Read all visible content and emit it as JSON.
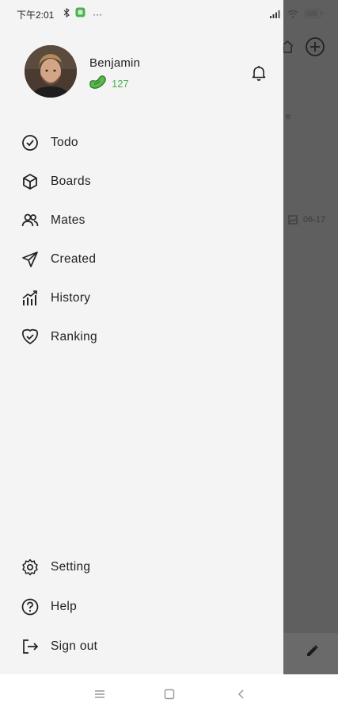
{
  "status_bar": {
    "time": "下午2:01",
    "more": "···"
  },
  "profile": {
    "name": "Benjamin",
    "points": "127"
  },
  "menu": {
    "items": [
      {
        "label": "Todo",
        "icon": "check-circle-icon"
      },
      {
        "label": "Boards",
        "icon": "cube-icon"
      },
      {
        "label": "Mates",
        "icon": "users-icon"
      },
      {
        "label": "Created",
        "icon": "send-icon"
      },
      {
        "label": "History",
        "icon": "bar-chart-icon"
      },
      {
        "label": "Ranking",
        "icon": "heart-check-icon"
      }
    ]
  },
  "footer_menu": {
    "items": [
      {
        "label": "Setting",
        "icon": "gear-icon"
      },
      {
        "label": "Help",
        "icon": "help-circle-icon"
      },
      {
        "label": "Sign out",
        "icon": "sign-out-icon"
      }
    ]
  },
  "background": {
    "partial_text_1": "e",
    "date": "06-17"
  },
  "colors": {
    "drawer_bg": "#f4f4f4",
    "scrim": "#5f5f5f",
    "accent_green": "#4caf50"
  }
}
